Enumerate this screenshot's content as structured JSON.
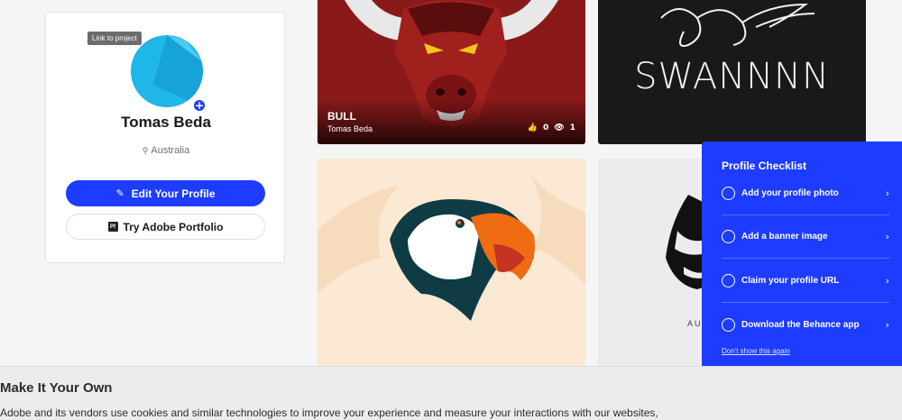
{
  "profile": {
    "tooltip": "Link to project",
    "name": "Tomas Beda",
    "location": "Australia",
    "edit_label": "Edit Your Profile",
    "portfolio_label": "Try Adobe Portfolio",
    "portfolio_icon_text": "Pf",
    "avatar_add_glyph": "+"
  },
  "projects": [
    {
      "title": "BULL",
      "owner": "Tomas Beda",
      "appreciations": "0",
      "views": "1"
    },
    {
      "image_text": "SWANNNN"
    },
    {
      "image_text": ""
    },
    {
      "image_text": "AUT"
    }
  ],
  "checklist": {
    "title": "Profile Checklist",
    "items": [
      {
        "label": "Add your profile photo"
      },
      {
        "label": "Add a banner image"
      },
      {
        "label": "Claim your profile URL"
      },
      {
        "label": "Download the Behance app"
      }
    ],
    "dismiss": "Don't show this again"
  },
  "cookie": {
    "title": "Make It Your Own",
    "text": "Adobe and its vendors use cookies and similar technologies to improve your experience and measure your interactions with our websites,"
  },
  "colors": {
    "accent": "#1d3cff",
    "avatar": "#1fb6e8"
  },
  "icons": {
    "location": "location-pin-icon",
    "edit": "pencil-icon",
    "appreciate": "thumbs-up-icon",
    "views": "eye-icon",
    "chevron": "chevron-right-icon"
  }
}
